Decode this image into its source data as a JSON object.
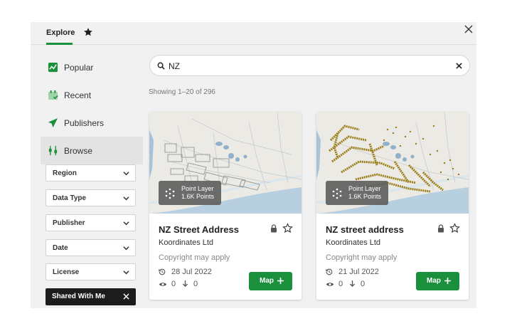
{
  "header": {
    "tab_explore": "Explore",
    "tab_favorites_icon": "star-icon",
    "close_icon": "close-icon"
  },
  "sidebar": {
    "items": [
      {
        "label": "Popular",
        "icon": "trend-line-icon"
      },
      {
        "label": "Recent",
        "icon": "calendar-check-icon"
      },
      {
        "label": "Publishers",
        "icon": "send-icon"
      },
      {
        "label": "Browse",
        "icon": "sliders-icon",
        "active": true
      }
    ],
    "filters": [
      {
        "label": "Region"
      },
      {
        "label": "Data Type"
      },
      {
        "label": "Publisher"
      },
      {
        "label": "Date"
      },
      {
        "label": "License"
      }
    ],
    "active_filter": {
      "label": "Shared With Me"
    }
  },
  "search": {
    "value": "NZ",
    "icon": "search-icon",
    "clear_icon": "close-icon"
  },
  "results": {
    "showing": "Showing 1–20 of 296",
    "cards": [
      {
        "badge_line1": "Point Layer",
        "badge_line2": "1.6K Points",
        "title": "NZ Street Address",
        "publisher": "Koordinates Ltd",
        "copyright": "Copyright may apply",
        "date": "28 Jul 2022",
        "views": "0",
        "downloads": "0",
        "map_label": "Map"
      },
      {
        "badge_line1": "Point Layer",
        "badge_line2": "1.6K Points",
        "title": "NZ street address",
        "publisher": "Koordinates Ltd",
        "copyright": "Copyright may apply",
        "date": "21 Jul 2022",
        "views": "0",
        "downloads": "0",
        "map_label": "Map"
      }
    ]
  },
  "colors": {
    "accent": "#1a8f3c",
    "dark_chip": "#1c1c1c",
    "point_color": "#9a7d16"
  }
}
